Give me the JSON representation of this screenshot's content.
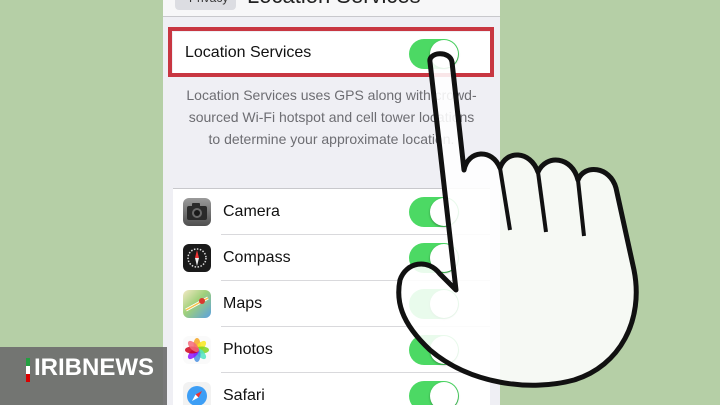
{
  "nav": {
    "back_label": "Privacy",
    "title": "Location Services"
  },
  "location_services": {
    "label": "Location Services",
    "enabled": true
  },
  "description": "Location Services uses GPS along with crowd-sourced Wi-Fi hotspot and cell tower locations to determine your approximate location.",
  "apps": [
    {
      "label": "Camera",
      "icon": "camera-icon",
      "enabled": true
    },
    {
      "label": "Compass",
      "icon": "compass-icon",
      "enabled": true
    },
    {
      "label": "Maps",
      "icon": "maps-icon",
      "enabled": true
    },
    {
      "label": "Photos",
      "icon": "photos-icon",
      "enabled": true
    },
    {
      "label": "Safari",
      "icon": "safari-icon",
      "enabled": true
    }
  ],
  "watermark": {
    "text": "IRIBNEWS"
  },
  "colors": {
    "toggle_on": "#4cd964",
    "highlight": "#c83641",
    "background": "#b5cfa6"
  }
}
